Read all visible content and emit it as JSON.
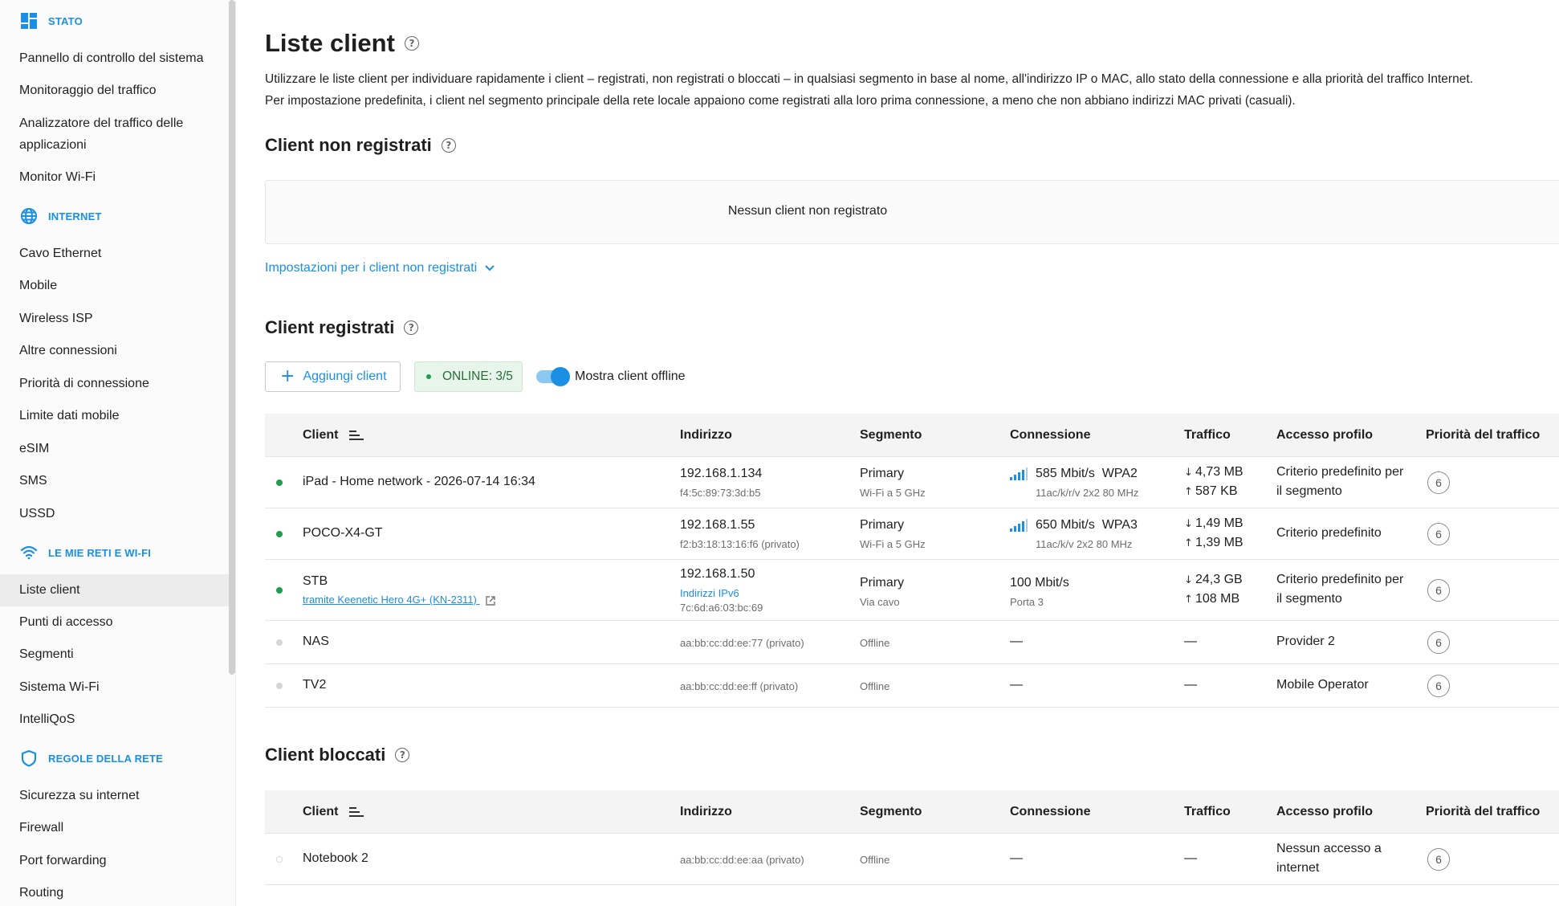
{
  "sidebar": {
    "sections": [
      {
        "label": "STATO",
        "icon": "dashboard-icon",
        "items": [
          "Pannello di controllo del sistema",
          "Monitoraggio del traffico",
          "Analizzatore del traffico delle",
          "applicazioni",
          "Monitor Wi-Fi"
        ]
      },
      {
        "label": "INTERNET",
        "icon": "globe-icon",
        "items": [
          "Cavo Ethernet",
          "Mobile",
          "Wireless ISP",
          "Altre connessioni",
          "Priorità di connessione",
          "Limite dati mobile",
          "eSIM",
          "SMS",
          "USSD"
        ]
      },
      {
        "label": "LE MIE RETI E WI-FI",
        "icon": "wifi-icon",
        "items": [
          "Liste client",
          "Punti di accesso",
          "Segmenti",
          "Sistema Wi-Fi",
          "IntelliQoS"
        ]
      },
      {
        "label": "REGOLE DELLA RETE",
        "icon": "shield-icon",
        "items": [
          "Sicurezza su internet",
          "Firewall",
          "Port forwarding",
          "Routing"
        ]
      }
    ]
  },
  "page": {
    "title": "Liste client",
    "desc1": "Utilizzare le liste client per individuare rapidamente i client – registrati, non registrati o bloccati – in qualsiasi segmento in base al nome, all'indirizzo IP o MAC, allo stato della connessione e alla priorità del traffico Internet.",
    "desc2": "Per impostazione predefinita, i client nel segmento principale della rete locale appaiono come registrati alla loro prima connessione, a meno che non abbiano indirizzi MAC privati (casuali)."
  },
  "unregistered": {
    "title": "Client non registrati",
    "empty": "Nessun client non registrato",
    "settings_link": "Impostazioni per i client non registrati"
  },
  "registered": {
    "title": "Client registrati",
    "add_button": "Aggiungi client",
    "online_badge": "ONLINE: 3/5",
    "toggle_label": "Mostra client offline",
    "toggle_on": true
  },
  "columns": [
    "Client",
    "Indirizzo",
    "Segmento",
    "Connessione",
    "Traffico",
    "Accesso profilo",
    "Priorità del traffico"
  ],
  "registered_rows": [
    {
      "status": "online",
      "name": "iPad - Home network - 2026-07-14 16:34",
      "ip": "192.168.1.134",
      "mac": "f4:5c:89:73:3d:b5",
      "segment": "Primary",
      "segment_sub": "Wi-Fi a 5 GHz",
      "conn_main": "585 Mbit/s  WPA2",
      "conn_sub": "11ac/k/r/v 2x2 80 MHz",
      "rx": "4,73 MB",
      "tx": "587 KB",
      "profile1": "Criterio predefinito per",
      "profile2": "il segmento",
      "priority": "6"
    },
    {
      "status": "online",
      "name": "POCO-X4-GT",
      "ip": "192.168.1.55",
      "mac": "f2:b3:18:13:16:f6 (privato)",
      "segment": "Primary",
      "segment_sub": "Wi-Fi a 5 GHz",
      "conn_main": "650 Mbit/s  WPA3",
      "conn_sub": "11ac/k/v 2x2 80 MHz",
      "rx": "1,49 MB",
      "tx": "1,39 MB",
      "profile1": "Criterio predefinito",
      "profile2": "",
      "priority": "6"
    },
    {
      "status": "online",
      "name": "STB",
      "name_link": "tramite Keenetic Hero 4G+ (KN-2311)",
      "ip": "192.168.1.50",
      "ipv6_link": "Indirizzi IPv6",
      "mac": "7c:6d:a6:03:bc:69",
      "segment": "Primary",
      "segment_sub": "Via cavo",
      "conn_main": "100 Mbit/s",
      "conn_sub": "Porta 3",
      "rx": "24,3 GB",
      "tx": "108 MB",
      "profile1": "Criterio predefinito per",
      "profile2": "il segmento",
      "priority": "6"
    },
    {
      "status": "offline",
      "name": "NAS",
      "mac": "aa:bb:cc:dd:ee:77 (privato)",
      "segment_sub": "Offline",
      "conn_main": "—",
      "traffic": "—",
      "profile1": "Provider 2",
      "priority": "6"
    },
    {
      "status": "offline",
      "name": "TV2",
      "mac": "aa:bb:cc:dd:ee:ff (privato)",
      "segment_sub": "Offline",
      "conn_main": "—",
      "traffic": "—",
      "profile1": "Mobile Operator",
      "priority": "6"
    }
  ],
  "blocked": {
    "title": "Client bloccati",
    "rows": [
      {
        "status": "blocked",
        "name": "Notebook 2",
        "mac": "aa:bb:cc:dd:ee:aa (privato)",
        "segment_sub": "Offline",
        "conn_main": "—",
        "traffic": "—",
        "profile1": "Nessun accesso a",
        "profile2": "internet",
        "priority": "6"
      }
    ]
  },
  "colors": {
    "accent": "#1a8fe3",
    "online": "#1f9d4a",
    "offline": "#d6d6d6"
  }
}
